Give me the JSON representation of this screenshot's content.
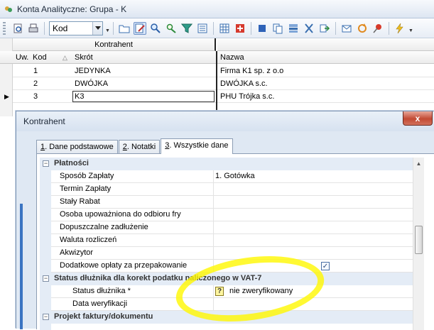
{
  "window": {
    "title": "Konta Analityczne: Grupa - K"
  },
  "toolbar": {
    "combo_value": "Kod",
    "icons": [
      "preview-icon",
      "print-icon",
      "folder-icon",
      "edit-icon",
      "find-icon",
      "find-next-icon",
      "filter-icon",
      "form-icon",
      "grid-icon",
      "add-red-icon",
      "square-blue-icon",
      "copy-icon",
      "group-icon",
      "cut-icon",
      "export-icon",
      "mail-icon",
      "refresh-icon",
      "pin-icon",
      "lightning-icon"
    ]
  },
  "grid": {
    "group_header": "Kontrahent",
    "columns": {
      "uw": "Uw.",
      "kod": "Kod",
      "skrot": "Skrót",
      "nazwa": "Nazwa"
    },
    "rows": [
      {
        "kod": "1",
        "skrot": "JEDYNKA",
        "nazwa": "Firma K1 sp. z o.o"
      },
      {
        "kod": "2",
        "skrot": "DWÓJKA",
        "nazwa": "DWÓJKA s.c."
      },
      {
        "kod": "3",
        "skrot": "K3",
        "nazwa": "PHU Trójka s.c."
      }
    ]
  },
  "dialog": {
    "title": "Kontrahent",
    "close_label": "x",
    "tabs": [
      {
        "num": "1",
        "label": ". Dane podstawowe"
      },
      {
        "num": "2",
        "label": ". Notatki"
      },
      {
        "num": "3",
        "label": ". Wszystkie dane"
      }
    ],
    "active_tab": 2,
    "categories": {
      "platnosci": {
        "title": "Płatności",
        "props": [
          {
            "name": "Sposób Zapłaty",
            "value": "1. Gotówka"
          },
          {
            "name": "Termin Zapłaty",
            "value": ""
          },
          {
            "name": "Stały Rabat",
            "value": ""
          },
          {
            "name": "Osoba upoważniona do odbioru fry",
            "value": ""
          },
          {
            "name": "Dopuszczalne zadłużenie",
            "value": ""
          },
          {
            "name": "Waluta rozliczeń",
            "value": ""
          },
          {
            "name": "Akwizytor",
            "value": ""
          },
          {
            "name": "Dodatkowe opłaty za przepakowanie",
            "value": ""
          }
        ],
        "checkbox_checked": true
      },
      "status": {
        "title": "Status dłużnika dla korekt podatku naliczonego w VAT-7",
        "props": [
          {
            "name": "Status dłużnika *",
            "value": "nie zweryfikowany"
          },
          {
            "name": "Data weryfikacji",
            "value": ""
          }
        ],
        "status_icon": "?"
      },
      "projekt": {
        "title": "Projekt faktury/dokumentu"
      }
    }
  }
}
